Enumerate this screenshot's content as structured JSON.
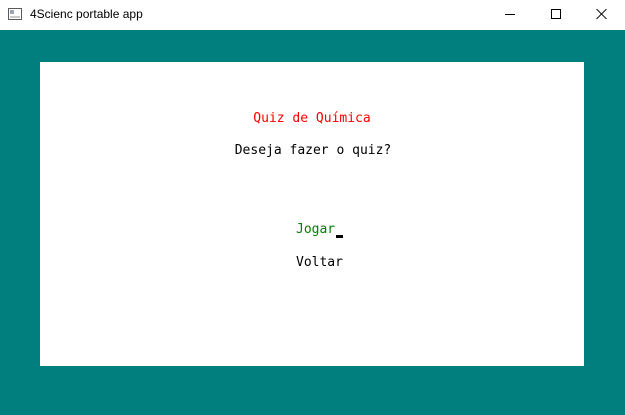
{
  "window": {
    "title": "4Scienc portable app",
    "controls": {
      "minimize_icon": "minimize-icon",
      "maximize_icon": "maximize-icon",
      "close_icon": "close-icon"
    }
  },
  "colors": {
    "background": "#007f7f",
    "panel": "#ffffff",
    "title": "#ff0000",
    "selected_option": "#008000",
    "text": "#000000"
  },
  "quiz": {
    "title": "Quiz de Química",
    "question": "Deseja fazer o quiz?",
    "options": [
      {
        "label": "Jogar",
        "selected": true
      },
      {
        "label": "Voltar",
        "selected": false
      }
    ]
  }
}
